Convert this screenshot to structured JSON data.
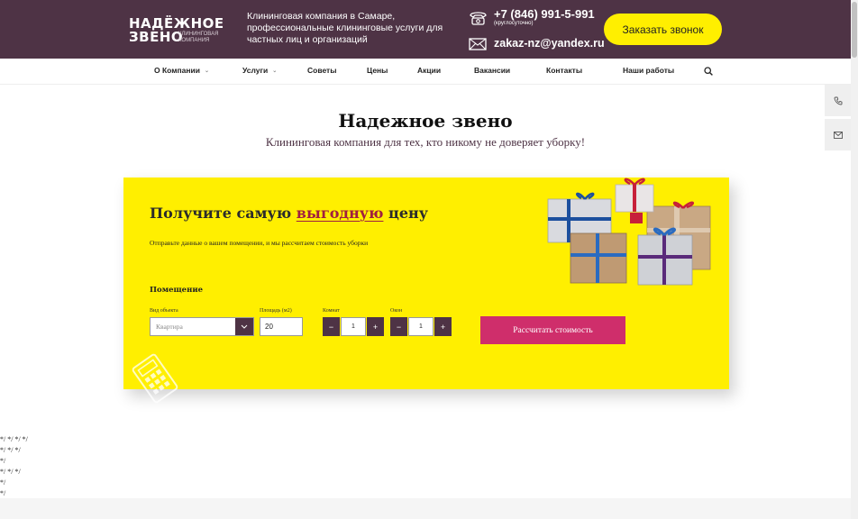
{
  "header": {
    "logo_line1": "НАДЁЖНОЕ",
    "logo_line2": "ЗВЕНО",
    "logo_sub": "клининговая компания",
    "tagline": "Клининговая компания в Самаре, профессиональные клининговые услуги для частных лиц и организаций",
    "phone": "+7 (846) 991-5-991",
    "phone_note": "(круглосуточно)",
    "email": "zakaz-nz@yandex.ru",
    "callback_button": "Заказать звонок",
    "bg_color": "#4e3345",
    "accent_color": "#ffef00"
  },
  "nav": {
    "items": [
      {
        "label": "О Компании",
        "has_dropdown": true
      },
      {
        "label": "Услуги",
        "has_dropdown": true
      },
      {
        "label": "Советы",
        "has_dropdown": false
      },
      {
        "label": "Цены",
        "has_dropdown": false
      },
      {
        "label": "Акции",
        "has_dropdown": false
      },
      {
        "label": "Вакансии",
        "has_dropdown": false
      },
      {
        "label": "Контакты",
        "has_dropdown": false
      },
      {
        "label": "Наши работы",
        "has_dropdown": false
      }
    ],
    "search_icon": "search-icon"
  },
  "side_widgets": [
    "phone-icon",
    "mail-icon"
  ],
  "main": {
    "title": "Надежное звено",
    "subtitle": "Клининговая компания для тех, кто никому не доверяет уборку!"
  },
  "calculator": {
    "title_before": "Получите самую",
    "title_highlight": "выгодную",
    "title_after": "цену",
    "description": "Отправьте данные о вашем помещении, и мы рассчитаем стоимость уборки",
    "section_label": "Помещение",
    "object_type_label": "Вид объекта",
    "object_type_value": "Квартира",
    "area_label": "Площадь (м2)",
    "area_value": "20",
    "rooms_label": "Комнат",
    "rooms_value": "1",
    "windows_label": "Окон",
    "windows_value": "1",
    "minus": "−",
    "plus": "+",
    "submit_button": "Рассчитать стоимость",
    "card_color": "#ffef00",
    "button_color": "#cf2e6b"
  },
  "stray_text": [
    "*/ */ */ */",
    "*/ */ */",
    "*/",
    "*/ */ */",
    "*/",
    "*/"
  ]
}
